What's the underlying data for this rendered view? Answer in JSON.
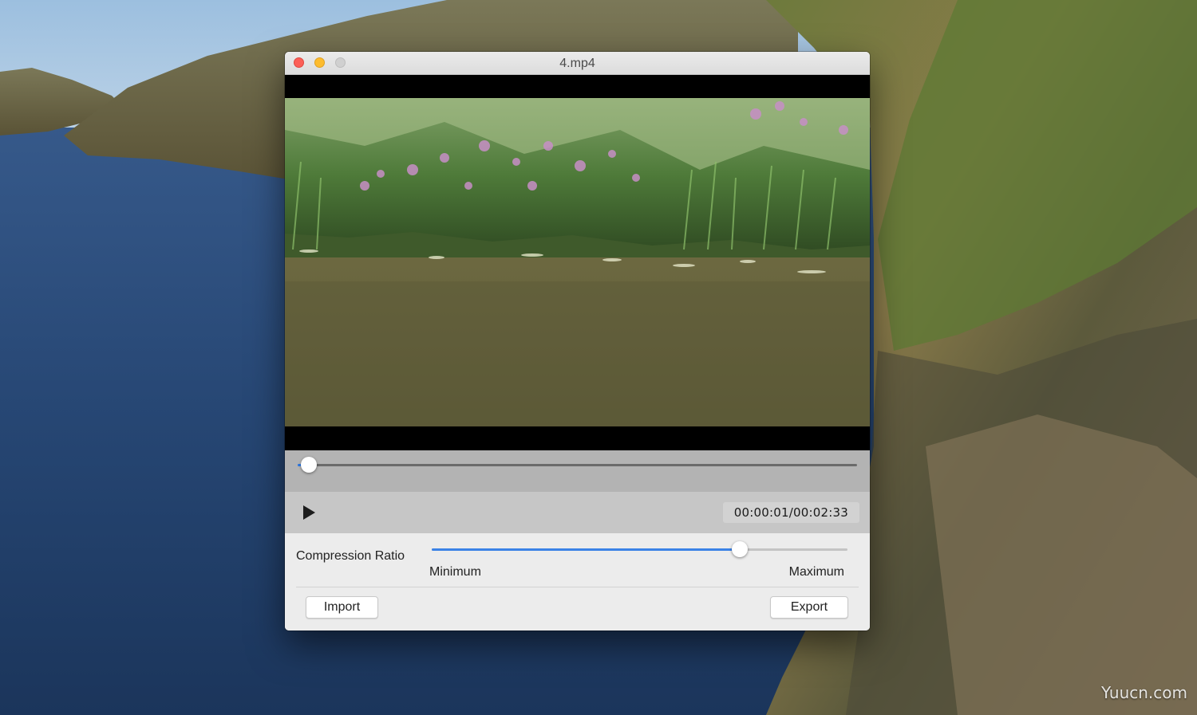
{
  "window": {
    "title": "4.mp4"
  },
  "player": {
    "current_time": "00:00:01",
    "duration": "00:02:33",
    "time_display": "00:00:01/00:02:33",
    "progress": 0.02
  },
  "compression": {
    "label": "Compression Ratio",
    "min_label": "Minimum",
    "max_label": "Maximum",
    "value": 0.74
  },
  "buttons": {
    "import_label": "Import",
    "export_label": "Export"
  },
  "icons": {
    "play": "play-icon",
    "close": "close-icon",
    "minimize": "minimize-icon",
    "zoom": "zoom-icon"
  },
  "colors": {
    "accent": "#3b82e6",
    "close": "#fc5f57",
    "minimize": "#fdbc2e",
    "zoom_disabled": "#d0d0d0"
  },
  "watermark": "Yuucn.com"
}
